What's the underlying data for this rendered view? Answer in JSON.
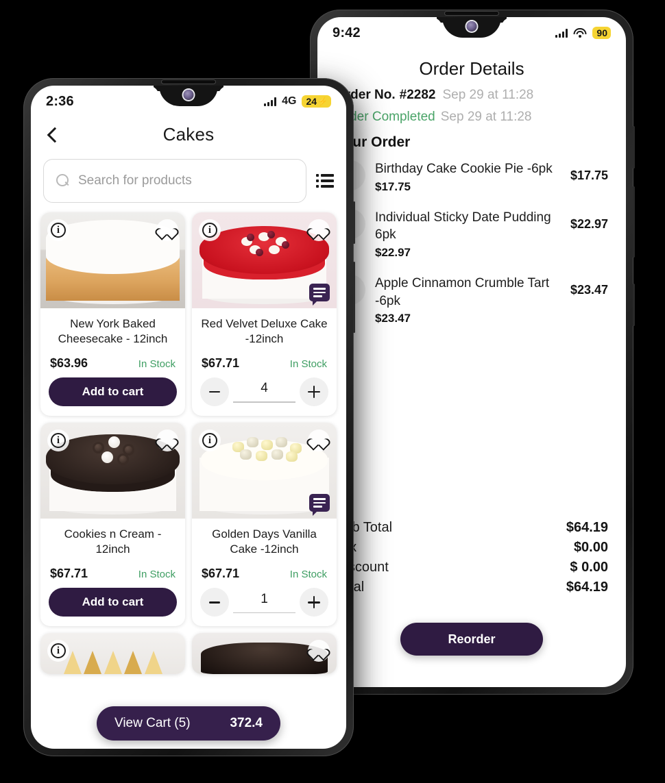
{
  "left_phone": {
    "status": {
      "time": "2:36",
      "network": "4G",
      "battery": "24",
      "battery_charging_glyph": "⚡",
      "signal_icon": "signal-bars-icon"
    },
    "appbar": {
      "back_icon": "back-chevron-icon",
      "title": "Cakes"
    },
    "search": {
      "icon": "search-icon",
      "placeholder": "Search for products",
      "view_toggle_icon": "list-view-icon"
    },
    "products": [
      {
        "name": "New York Baked Cheesecake - 12inch",
        "price": "$63.96",
        "stock": "In Stock",
        "action_label": "Add to cart",
        "has_stepper": false,
        "quantity": "",
        "has_note_badge": false,
        "info_icon": "info-icon",
        "favorite_icon": "heart-icon"
      },
      {
        "name": "Red Velvet Deluxe Cake -12inch",
        "price": "$67.71",
        "stock": "In Stock",
        "action_label": "",
        "has_stepper": true,
        "quantity": "4",
        "has_note_badge": true,
        "info_icon": "info-icon",
        "favorite_icon": "heart-icon"
      },
      {
        "name": "Cookies n Cream - 12inch",
        "price": "$67.71",
        "stock": "In Stock",
        "action_label": "Add to cart",
        "has_stepper": false,
        "quantity": "",
        "has_note_badge": false,
        "info_icon": "info-icon",
        "favorite_icon": "heart-icon"
      },
      {
        "name": "Golden Days Vanilla Cake -12inch",
        "price": "$67.71",
        "stock": "In Stock",
        "action_label": "",
        "has_stepper": true,
        "quantity": "1",
        "has_note_badge": true,
        "info_icon": "info-icon",
        "favorite_icon": "heart-icon"
      }
    ],
    "view_cart": {
      "label": "View Cart",
      "count": "(5)",
      "total": "372.4"
    }
  },
  "right_phone": {
    "status": {
      "time": "9:42",
      "battery": "90",
      "signal_icon": "signal-bars-icon",
      "wifi_icon": "wifi-icon"
    },
    "title": "Order Details",
    "order_no_label": "Order No.",
    "order_no": "#2282",
    "order_no_datetime": "Sep 29 at 11:28",
    "order_status": "Order Completed",
    "order_status_datetime": "Sep 29 at 11:28",
    "section_label": "Your Order",
    "items": [
      {
        "name": "Birthday Cake Cookie Pie -6pk",
        "unit_price": "$17.75",
        "amount": "$17.75"
      },
      {
        "name": "Individual Sticky Date Pudding 6pk",
        "unit_price": "$22.97",
        "amount": "$22.97"
      },
      {
        "name": "Apple Cinnamon Crumble Tart -6pk",
        "unit_price": "$23.47",
        "amount": "$23.47"
      }
    ],
    "totals": [
      {
        "label": "Sub Total",
        "value": "$64.19"
      },
      {
        "label": "Tax",
        "value": "$0.00"
      },
      {
        "label": "Discount",
        "value": "$ 0.00"
      },
      {
        "label": "Total",
        "value": "$64.19"
      }
    ],
    "reorder_label": "Reorder"
  },
  "colors": {
    "brand_purple": "#2F1B42",
    "cart_purple": "#36204C",
    "note_badge_purple": "#3A2352",
    "in_stock_green": "#3f9e63",
    "status_green": "#4aa468",
    "battery_yellow": "#F6D433",
    "muted_gray": "#aeaeae",
    "background": "#000000"
  }
}
